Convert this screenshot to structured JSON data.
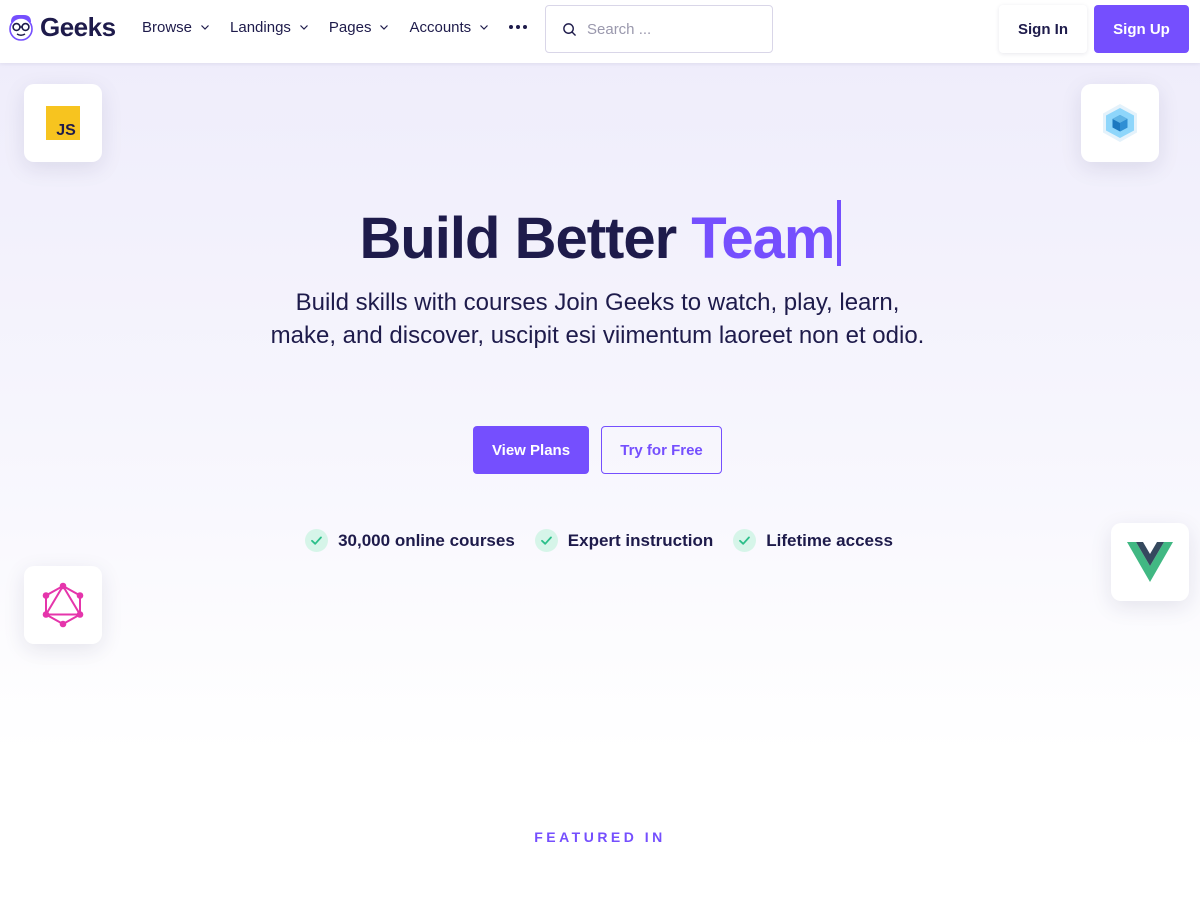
{
  "brand": {
    "name": "Geeks"
  },
  "nav": {
    "items": [
      {
        "label": "Browse"
      },
      {
        "label": "Landings"
      },
      {
        "label": "Pages"
      },
      {
        "label": "Accounts"
      }
    ]
  },
  "search": {
    "placeholder": "Search ..."
  },
  "auth": {
    "signin_label": "Sign In",
    "signup_label": "Sign Up"
  },
  "hero": {
    "title_main": "Build Better ",
    "title_accent": "Team",
    "subtitle": "Build skills with courses Join Geeks to watch, play, learn, make, and discover, uscipit esi viimentum laoreet non et odio.",
    "primary_button": "View Plans",
    "secondary_button": "Try for Free",
    "features": [
      {
        "label": "30,000 online courses"
      },
      {
        "label": "Expert instruction"
      },
      {
        "label": "Lifetime access"
      }
    ],
    "icons": [
      "javascript-icon",
      "webpack-icon",
      "graphql-icon",
      "vue-icon"
    ],
    "js_badge_text": "JS"
  },
  "featured": {
    "heading": "FEATURED IN"
  },
  "colors": {
    "accent": "#754ffe",
    "text": "#1e1b4b",
    "check_bg": "#d6f5e9",
    "check_mark": "#2bbf8a"
  }
}
